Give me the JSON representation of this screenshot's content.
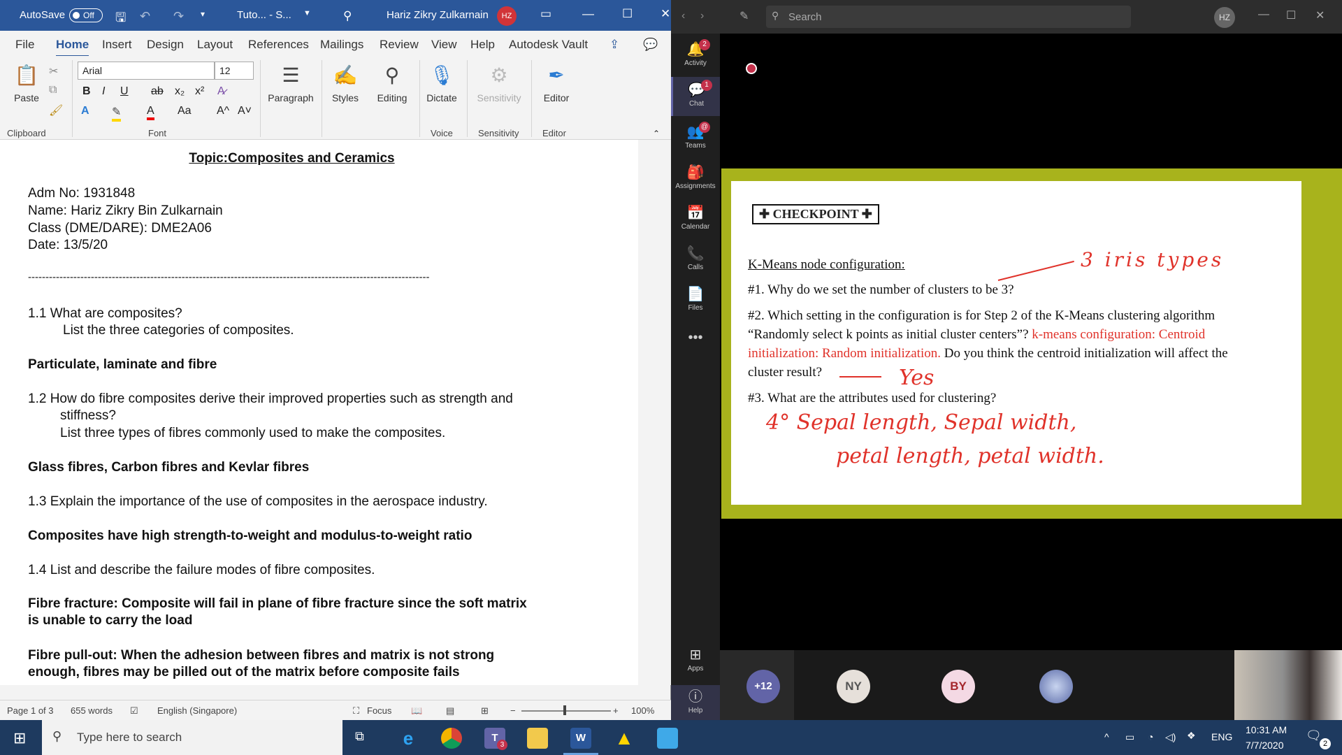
{
  "word": {
    "titlebar": {
      "autosave_label": "AutoSave",
      "autosave_state": "Off",
      "doc_title": "Tuto... - S...",
      "user_name": "Hariz Zikry Zulkarnain",
      "user_initials": "HZ"
    },
    "menu": [
      "File",
      "Home",
      "Insert",
      "Design",
      "Layout",
      "References",
      "Mailings",
      "Review",
      "View",
      "Help",
      "Autodesk Vault"
    ],
    "ribbon": {
      "paste": "Paste",
      "clipboard": "Clipboard",
      "font_name": "Arial",
      "font_size": "12",
      "font_group": "Font",
      "paragraph": "Paragraph",
      "styles": "Styles",
      "editing": "Editing",
      "dictate": "Dictate",
      "sensitivity": "Sensitivity",
      "editor": "Editor",
      "voice": "Voice",
      "sensitivity_group": "Sensitivity",
      "editor_group": "Editor"
    },
    "doc": {
      "title": "Topic:Composites and Ceramics",
      "adm": "Adm No: 1931848",
      "name": "Name: Hariz Zikry Bin Zulkarnain",
      "class": "Class (DME/DARE): DME2A06",
      "date": "Date: 13/5/20",
      "divider": "-------------------------------------------------------------------------------------------------------------------",
      "q1": "1.1 What are composites?",
      "q1b": "List the three categories of composites.",
      "a1": "Particulate, laminate and fibre",
      "q2": "1.2 How do fibre composites derive their improved properties such as strength and",
      "q2b": "stiffness?",
      "q2c": "List three types of fibres commonly used to make the composites.",
      "a2": "Glass fibres, Carbon fibres and Kevlar fibres",
      "q3": "1.3 Explain the importance of the use of composites in the aerospace industry.",
      "a3": "Composites have high strength-to-weight and modulus-to-weight ratio",
      "q4": "1.4 List and describe the failure modes of fibre composites.",
      "a4a": "Fibre fracture: Composite will fail in plane of fibre fracture since the soft matrix",
      "a4b": "is unable to carry the load",
      "a5a": "Fibre pull-out: When the adhesion between fibres and matrix is not strong",
      "a5b": "enough, fibres may be pilled out of the matrix before composite fails"
    },
    "status": {
      "page": "Page 1 of 3",
      "words": "655 words",
      "language": "English (Singapore)",
      "focus": "Focus",
      "zoom": "100%"
    }
  },
  "teams": {
    "search_placeholder": "Search",
    "user_initials": "HZ",
    "rail": [
      {
        "label": "Activity",
        "icon": "bell-icon",
        "badge": "2"
      },
      {
        "label": "Chat",
        "icon": "chat-icon",
        "badge": "1"
      },
      {
        "label": "Teams",
        "icon": "teams-icon",
        "badge": "@"
      },
      {
        "label": "Assignments",
        "icon": "assignments-icon",
        "badge": ""
      },
      {
        "label": "Calendar",
        "icon": "calendar-icon",
        "badge": ""
      },
      {
        "label": "Calls",
        "icon": "phone-icon",
        "badge": ""
      },
      {
        "label": "Files",
        "icon": "file-icon",
        "badge": ""
      }
    ],
    "apps_label": "Apps",
    "help_label": "Help",
    "slide": {
      "checkpoint": "CHECKPOINT",
      "heading": "K-Means node configuration:",
      "q1": "#1. Why do we set the number of clusters to be 3?",
      "q2a": "#2. Which setting in the configuration is for Step 2 of the K-Means clustering algorithm",
      "q2b_black": "“Randomly select k points as initial cluster centers”?",
      "q2b_red": "k-means configuration: Centroid",
      "q2c_red": "initialization: Random initialization.",
      "q2c_black": "Do you think the centroid initialization will affect the",
      "q2d": "cluster result?",
      "q3": "#3. What are the attributes used for clustering?",
      "hw1": "3 iris types",
      "hw2": "Yes",
      "hw3a": "4° Sepal length, Sepal width,",
      "hw3b": "petal length, petal width."
    },
    "participants": [
      "+12",
      "NY",
      "BY"
    ]
  },
  "taskbar": {
    "search_placeholder": "Type here to search",
    "teams_badge": "3",
    "lang": "ENG",
    "time": "10:31 AM",
    "date": "7/7/2020",
    "notif": "2"
  }
}
